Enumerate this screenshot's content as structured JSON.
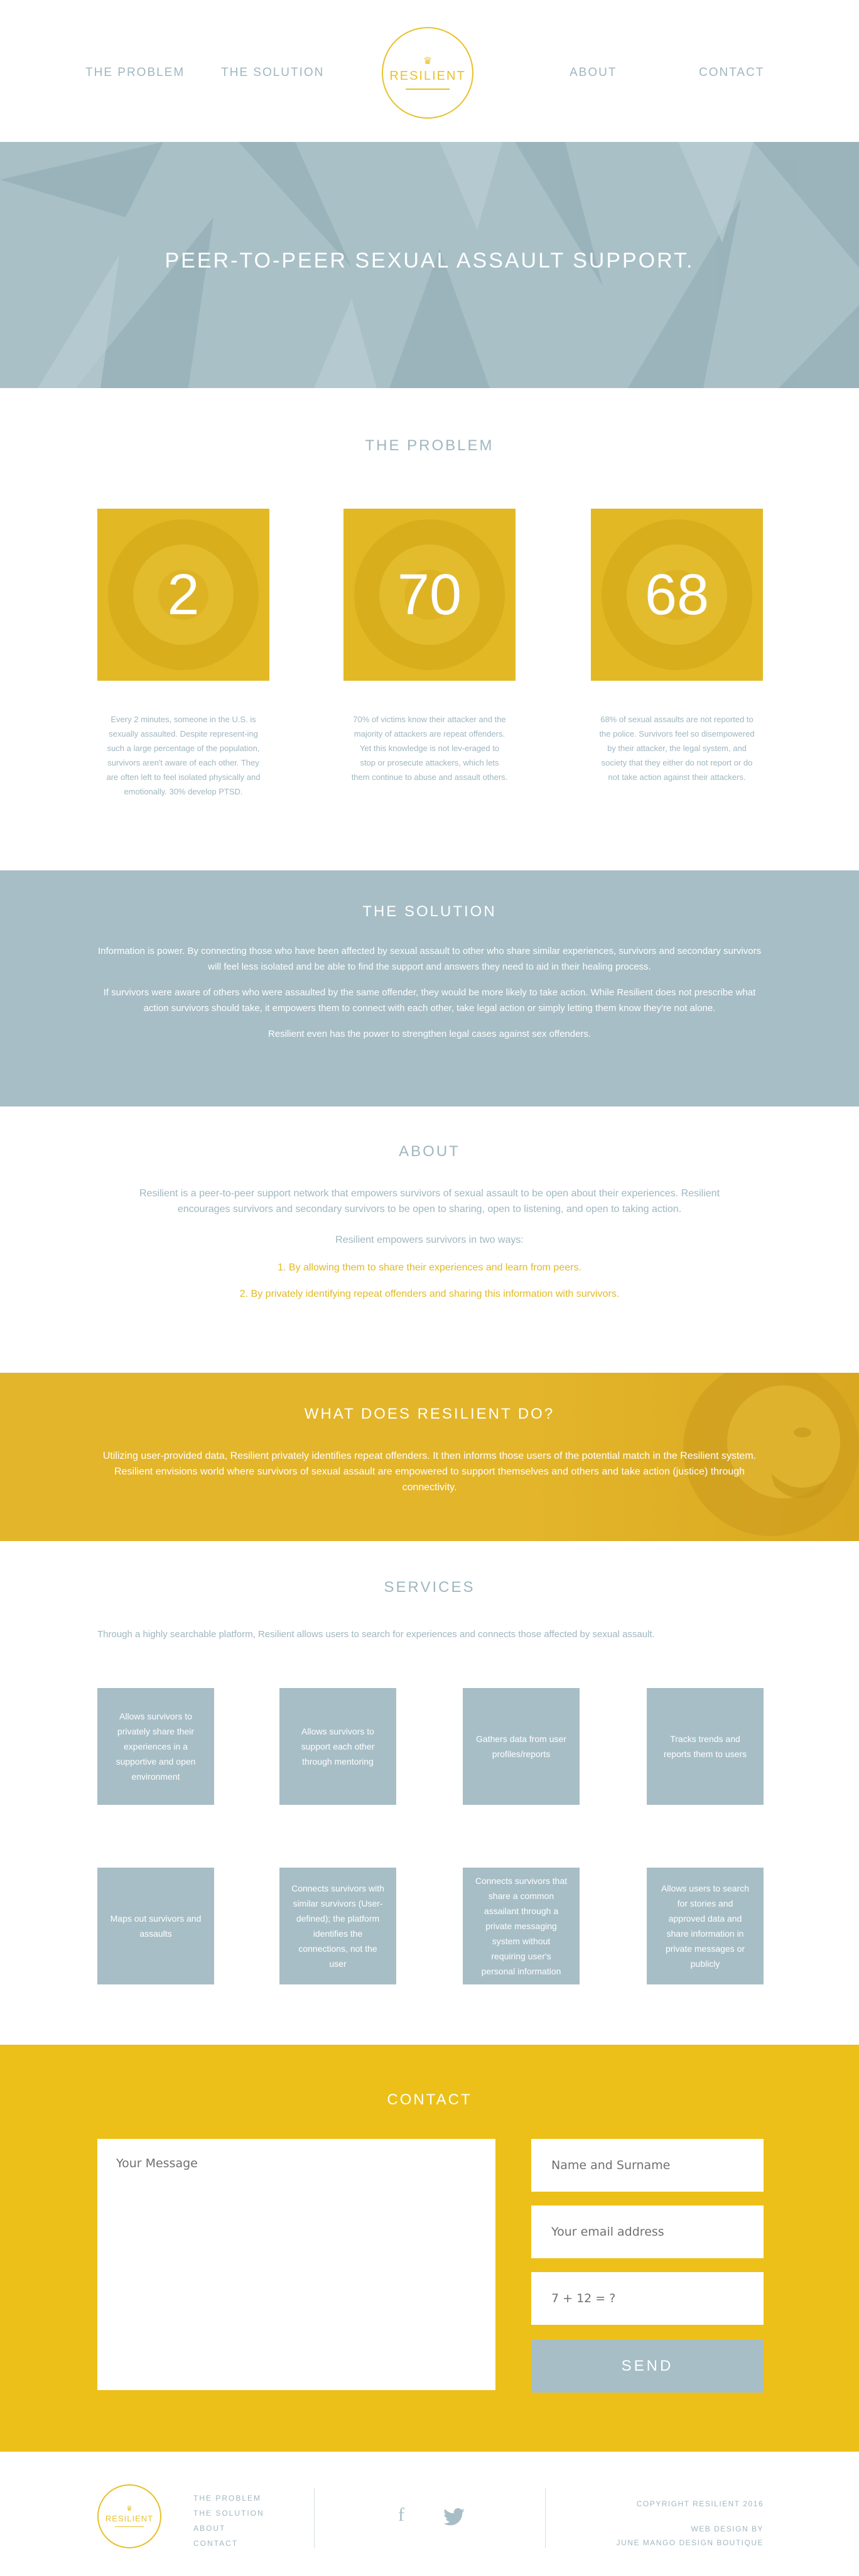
{
  "nav": {
    "problem": "THE PROBLEM",
    "solution": "THE SOLUTION",
    "about": "ABOUT",
    "contact": "CONTACT",
    "logo_text": "RESILIENT"
  },
  "hero": {
    "title": "PEER-TO-PEER SEXUAL ASSAULT SUPPORT."
  },
  "problem": {
    "title": "THE PROBLEM",
    "stats": [
      {
        "number": "2",
        "text": "Every 2 minutes, someone in the U.S. is sexually assaulted. Despite represent-ing such a large percentage of the population, survivors aren't aware of each other. They are often left to feel isolated physically and emotionally. 30% develop PTSD."
      },
      {
        "number": "70",
        "text": "70% of victims know their attacker and the majority of attackers are repeat offenders. Yet this knowledge is not lev-eraged to stop or prosecute attackers, which lets them continue to abuse and assault others."
      },
      {
        "number": "68",
        "text": "68% of sexual assaults are not reported to the police. Survivors feel so disempowered by their attacker, the legal system, and society that they either do not report or do not take action against their attackers."
      }
    ]
  },
  "solution": {
    "title": "THE SOLUTION",
    "p1": "Information is power. By connecting those who have been affected by sexual assault to other who share similar experiences, survivors and secondary survivors will feel less isolated and be able to find the support and answers they need to aid in their healing process.",
    "p2": "If survivors were aware of others who were assaulted by the same offender, they would be more likely to take action. While Resilient does not prescribe what action survivors should take, it empowers them to connect with each other, take legal action or simply letting them know they're not alone.",
    "p3": "Resilient even has the power to strengthen legal cases against sex offenders."
  },
  "about": {
    "title": "ABOUT",
    "intro": "Resilient is a peer-to-peer support network that empowers survivors of sexual assault to be open about their experiences. Resilient encourages survivors and secondary survivors to be open to sharing, open to listening, and open to taking action.",
    "lead": "Resilient empowers survivors in two ways:",
    "item1": "1.   By allowing them to share their experiences and learn from peers.",
    "item2": "2.   By privately identifying repeat offenders and sharing this information with survivors."
  },
  "what": {
    "title": "WHAT DOES RESILIENT DO?",
    "text": "Utilizing user-provided data, Resilient privately identifies repeat offenders. It then informs those users of the potential match in the Resilient system. Resilient envisions world where survivors of sexual assault are empowered to support themselves and others and take action (justice) through connectivity."
  },
  "services": {
    "title": "SERVICES",
    "intro": "Through a highly searchable platform, Resilient allows users to search for experiences and connects those affected by sexual assault.",
    "cards": [
      "Allows survivors to privately share their experiences in a supportive and open environment",
      "Allows survivors to support each other through mentoring",
      "Gathers data from user profiles/reports",
      "Tracks trends and reports them to users",
      "Maps out survivors and assaults",
      "Connects survivors with similar survivors (User-defined); the platform identifies the connections, not the user",
      "Connects survivors that share a common assailant through a private messaging system without requiring user's personal information",
      "Allows users to search for stories and approved data and share information in private messages or publicly"
    ]
  },
  "contact": {
    "title": "CONTACT",
    "message_placeholder": "Your Message",
    "name_placeholder": "Name and Surname",
    "email_placeholder": "Your email address",
    "captcha_placeholder": "7 + 12 = ?",
    "send": "SEND"
  },
  "footer": {
    "logo_text": "RESILIENT",
    "links": [
      "THE PROBLEM",
      "THE SOLUTION",
      "ABOUT",
      "CONTACT"
    ],
    "facebook_glyph": "f",
    "copyright": "COPYRIGHT RESILIENT 2016",
    "design_by": "WEB DESIGN BY",
    "studio": "JUNE MANGO DESIGN BOUTIQUE"
  },
  "colors": {
    "accent_yellow": "#ecc018",
    "slate_blue": "#a7bec6",
    "text_blue": "#9fb7c0"
  }
}
